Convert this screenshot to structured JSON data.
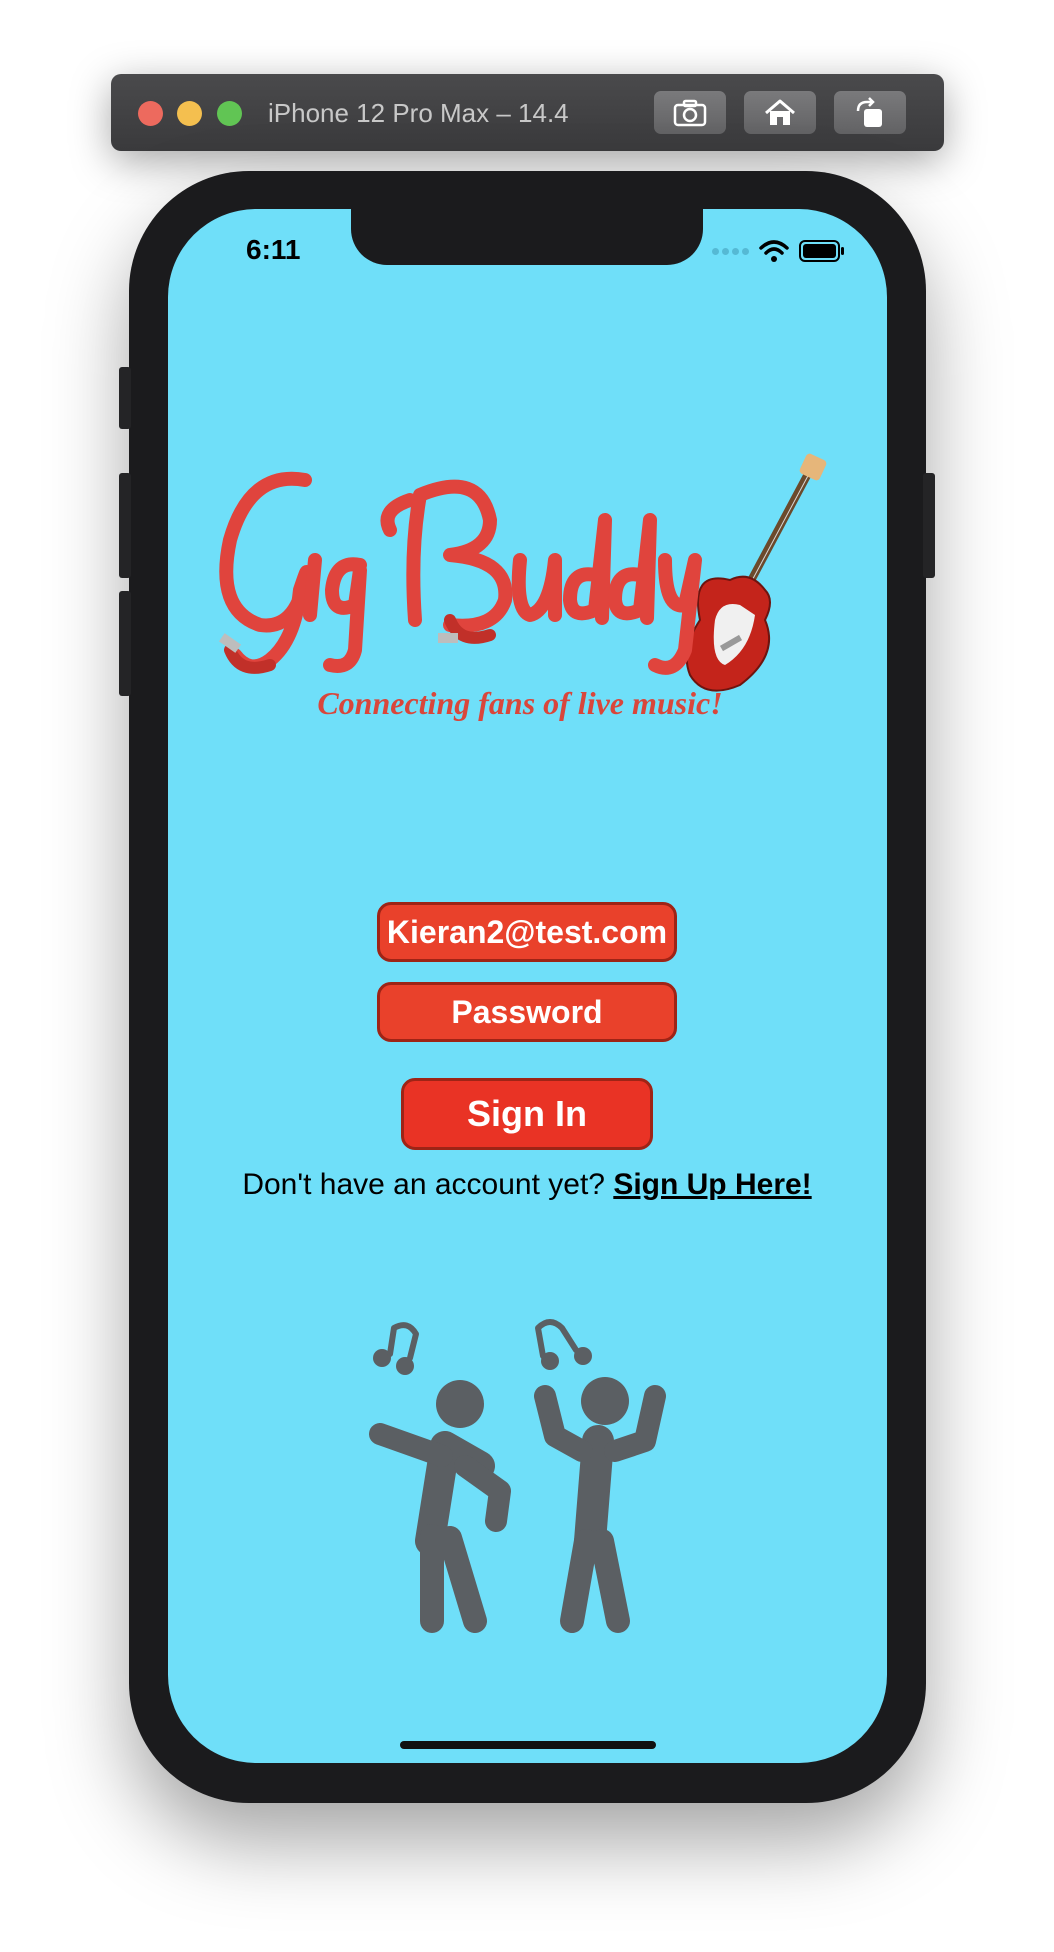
{
  "simulator": {
    "title": "iPhone 12 Pro Max – 14.4",
    "buttons": [
      "camera-icon",
      "home-icon",
      "rotate-icon"
    ]
  },
  "status_bar": {
    "time": "6:11"
  },
  "logo": {
    "name": "Gig Buddy",
    "tagline": "Connecting fans of live music!"
  },
  "login": {
    "email_value": "Kieran2@test.com",
    "password_placeholder": "Password",
    "sign_in_label": "Sign In",
    "signup_prompt": "Don't have an account yet?",
    "signup_link": "Sign Up Here!"
  },
  "colors": {
    "background": "#6fdff9",
    "accent_red": "#e9412b",
    "button_border": "#9e2416",
    "icon_gray": "#5b5f63"
  }
}
